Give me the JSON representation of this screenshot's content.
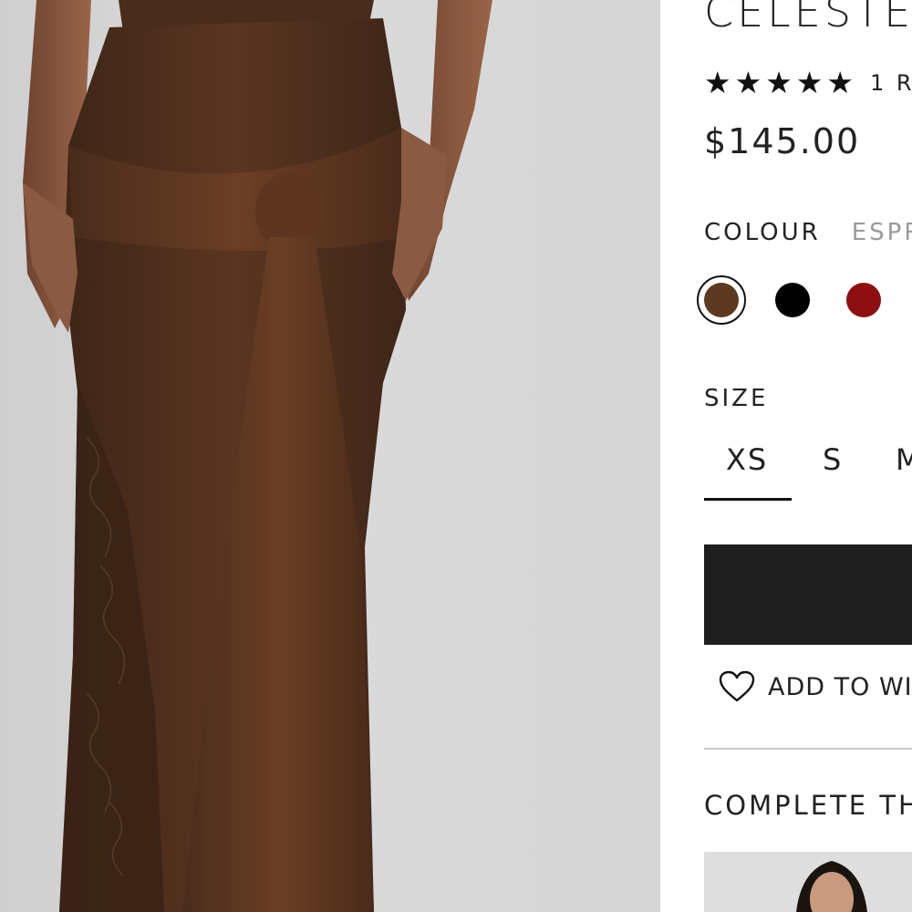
{
  "product": {
    "title": "CELESTE",
    "image_alt": "Model wearing brown lace maxi skirt with knot detail",
    "rating": {
      "stars": 5,
      "count_text": "1 R"
    },
    "price": "$145.00"
  },
  "colour": {
    "label": "COLOUR",
    "selected_value": "ESPR",
    "swatches": [
      {
        "name": "espresso",
        "color": "#5b3a21",
        "selected": true
      },
      {
        "name": "black",
        "color": "#000000",
        "selected": false
      },
      {
        "name": "red",
        "color": "#8e0f12",
        "selected": false
      }
    ]
  },
  "size": {
    "label": "SIZE",
    "options": [
      "XS",
      "S",
      "M"
    ],
    "selected": "XS"
  },
  "actions": {
    "add_to_bag_label": "",
    "wishlist_label": "ADD TO WIS"
  },
  "complete_the_look": {
    "heading": "COMPLETE TH"
  },
  "colors": {
    "button_bg": "#1e1e1e",
    "divider": "#c8c8c8",
    "muted_text": "#9a9a9a"
  }
}
